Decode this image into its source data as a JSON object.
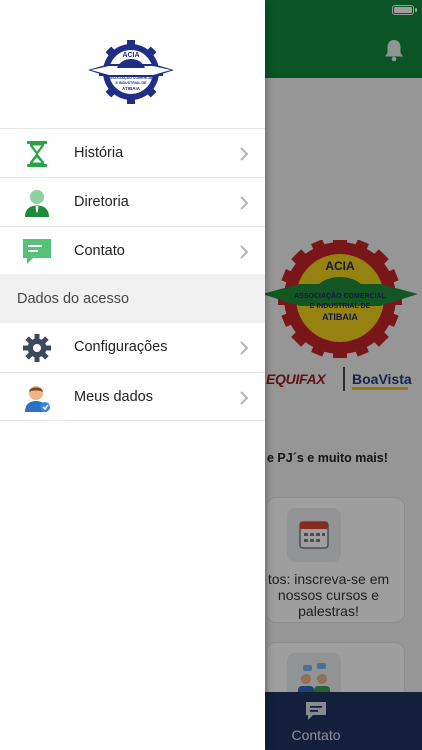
{
  "app": {
    "header_color": "#11883d",
    "tabbar_color": "#1f3360"
  },
  "drawer": {
    "logo": {
      "text_top": "ACIA",
      "text_lines": [
        "ASSOCIAÇÃO COMERCIAL",
        "E INDUSTRIAL DE",
        "ATIBAIA"
      ]
    },
    "menu_top": [
      {
        "label": "História",
        "icon": "hourglass-icon"
      },
      {
        "label": "Diretoria",
        "icon": "person-icon"
      },
      {
        "label": "Contato",
        "icon": "chat-bubble-icon"
      }
    ],
    "section_title": "Dados do acesso",
    "menu_bottom": [
      {
        "label": "Configurações",
        "icon": "gear-icon"
      },
      {
        "label": "Meus dados",
        "icon": "user-profile-icon"
      }
    ]
  },
  "background": {
    "hero_logo": {
      "text_top": "ACIA",
      "text_lines": [
        "ASSOCIAÇÃO COMERCIAL",
        "E INDUSTRIAL DE",
        "ATIBAIA"
      ]
    },
    "partner_1": "EQUIFAX",
    "partner_2": "BoaVista",
    "tagline": "e PJ´s e muito mais!",
    "card_events_text": "tos: inscreva-se em\nnossos cursos e\npalestras!",
    "tab_label": "Contato"
  }
}
